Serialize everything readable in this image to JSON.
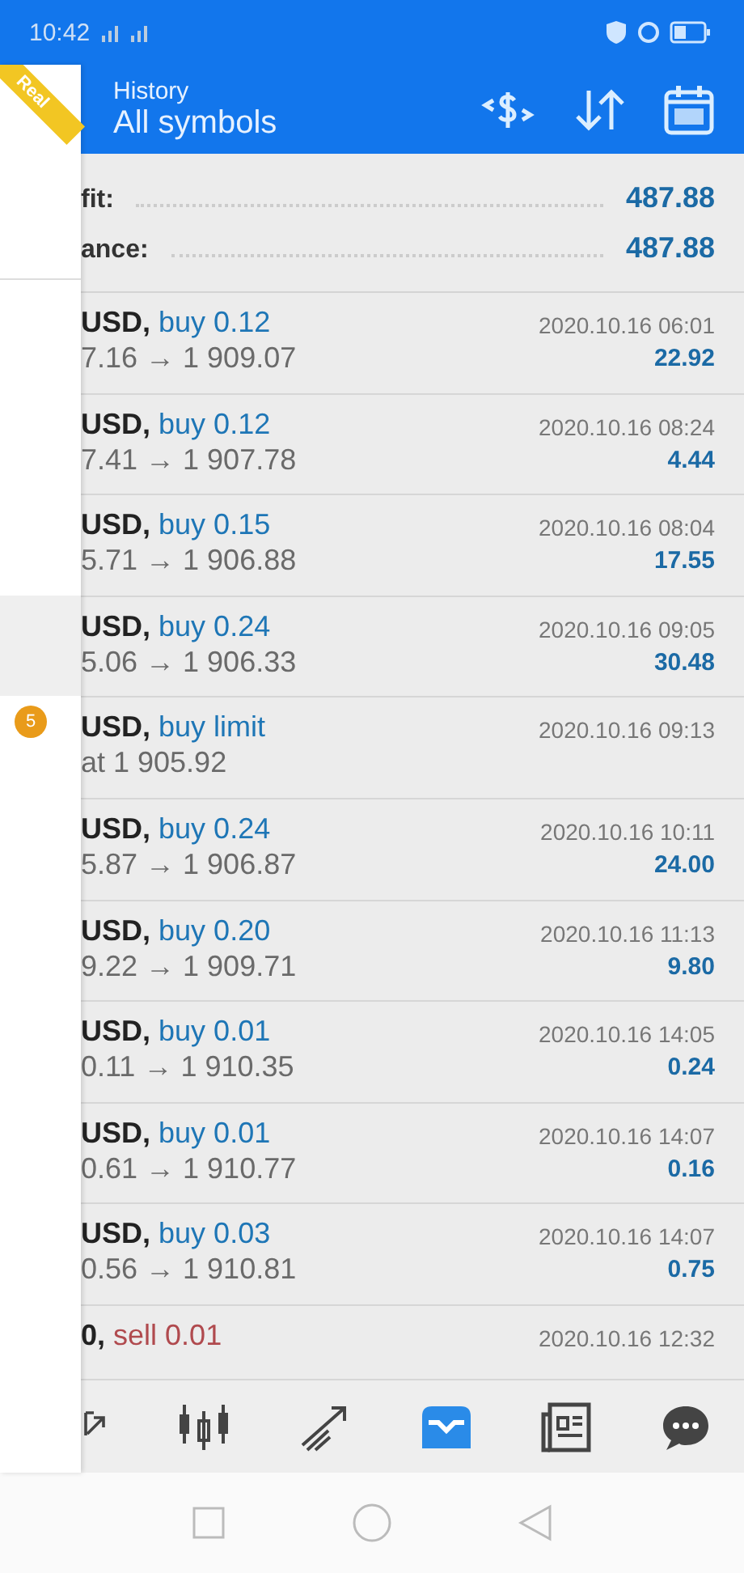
{
  "status_bar": {
    "time": "10:42"
  },
  "header": {
    "title": "History",
    "subtitle": "All symbols"
  },
  "drawer": {
    "ribbon": "Real",
    "items": [
      {
        "selected": true
      },
      {
        "badge": "5",
        "selected": false
      }
    ]
  },
  "summary": [
    {
      "label": "fit:",
      "value": "487.88"
    },
    {
      "label": "ance:",
      "value": "487.88"
    }
  ],
  "trades": [
    {
      "symbol": "USD,",
      "kind": "buy",
      "order": "buy 0.12",
      "prices": "7.16 → 1 909.07",
      "time": "2020.10.16 06:01",
      "profit": "22.92"
    },
    {
      "symbol": "USD,",
      "kind": "buy",
      "order": "buy 0.12",
      "prices": "7.41 → 1 907.78",
      "time": "2020.10.16 08:24",
      "profit": "4.44"
    },
    {
      "symbol": "USD,",
      "kind": "buy",
      "order": "buy 0.15",
      "prices": "5.71 → 1 906.88",
      "time": "2020.10.16 08:04",
      "profit": "17.55"
    },
    {
      "symbol": "USD,",
      "kind": "buy",
      "order": "buy 0.24",
      "prices": "5.06 → 1 906.33",
      "time": "2020.10.16 09:05",
      "profit": "30.48"
    },
    {
      "symbol": "USD,",
      "kind": "buy",
      "order": "buy limit",
      "prices": "at 1 905.92",
      "time": "2020.10.16 09:13"
    },
    {
      "symbol": "USD,",
      "kind": "buy",
      "order": "buy 0.24",
      "prices": "5.87 → 1 906.87",
      "time": "2020.10.16 10:11",
      "profit": "24.00"
    },
    {
      "symbol": "USD,",
      "kind": "buy",
      "order": "buy 0.20",
      "prices": "9.22 → 1 909.71",
      "time": "2020.10.16 11:13",
      "profit": "9.80"
    },
    {
      "symbol": "USD,",
      "kind": "buy",
      "order": "buy 0.01",
      "prices": "0.11 → 1 910.35",
      "time": "2020.10.16 14:05",
      "profit": "0.24"
    },
    {
      "symbol": "USD,",
      "kind": "buy",
      "order": "buy 0.01",
      "prices": "0.61 → 1 910.77",
      "time": "2020.10.16 14:07",
      "profit": "0.16"
    },
    {
      "symbol": "USD,",
      "kind": "buy",
      "order": "buy 0.03",
      "prices": "0.56 → 1 910.81",
      "time": "2020.10.16 14:07",
      "profit": "0.75"
    },
    {
      "symbol": "0,",
      "kind": "sell",
      "order": "sell 0.01",
      "time": "2020.10.16 12:32"
    }
  ],
  "tabs": [
    {
      "kind": "quotes",
      "selected": false
    },
    {
      "kind": "chart",
      "selected": false
    },
    {
      "kind": "trade",
      "selected": false
    },
    {
      "kind": "history",
      "selected": true
    },
    {
      "kind": "news",
      "selected": false
    },
    {
      "kind": "chat",
      "selected": false
    }
  ]
}
